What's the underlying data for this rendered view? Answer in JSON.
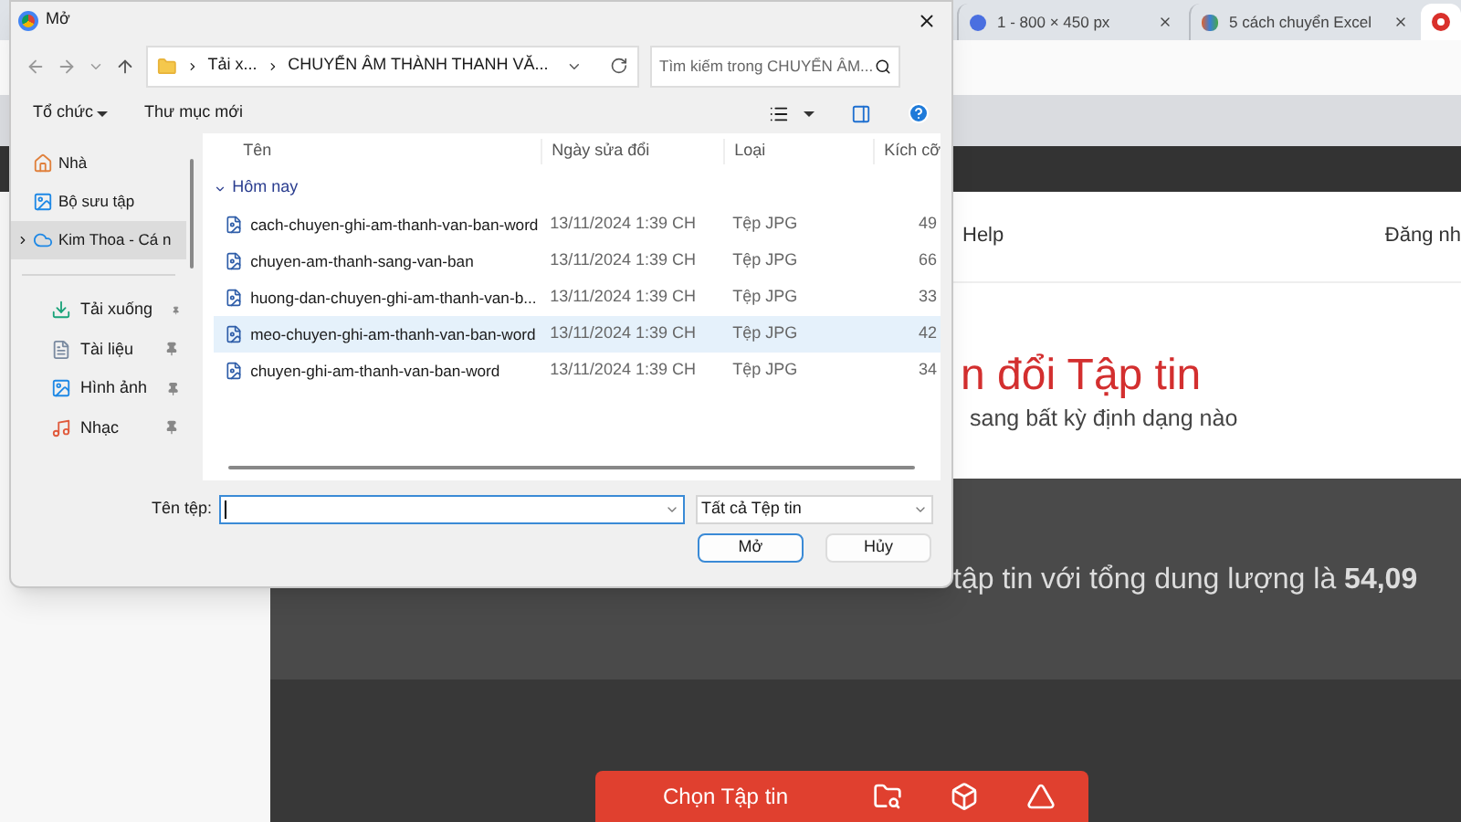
{
  "browser": {
    "tabs": [
      {
        "title": "1 - 800 × 450 px",
        "selected": false
      },
      {
        "title": "5 cách chuyển Excel",
        "selected": false
      },
      {
        "selected": true
      }
    ]
  },
  "page": {
    "nav_links": [
      "Help",
      "Đăng nh"
    ],
    "heading": "n đổi Tập tin",
    "subheading": "sang bất kỳ định dạng nào",
    "info": "tập tin với tổng dung lượng là **54,09**",
    "upload_button": "Chọn Tập tin"
  },
  "dialog": {
    "title": "Mở",
    "breadcrumb": [
      "Tải x...",
      "CHUYỂN ÂM THÀNH THANH VĂ..."
    ],
    "search": {
      "placeholder": "Tìm kiếm trong CHUYỂN ÂM..."
    },
    "toolbar": {
      "organize": "Tổ chức",
      "new_folder": "Thư mục mới"
    },
    "sidebar": {
      "locations": [
        {
          "label": "Nhà",
          "kind": "home",
          "selected": false
        },
        {
          "label": "Bộ sưu tập",
          "kind": "gallery",
          "selected": false
        },
        {
          "label": "Kim Thoa - Cá n",
          "kind": "cloud",
          "selected": true
        }
      ],
      "quick_access": [
        {
          "label": "Tải xuống",
          "kind": "downloads",
          "pinned": true
        },
        {
          "label": "Tài liệu",
          "kind": "documents",
          "pinned": true
        },
        {
          "label": "Hình ảnh",
          "kind": "pictures",
          "pinned": true
        },
        {
          "label": "Nhạc",
          "kind": "music",
          "pinned": true
        }
      ]
    },
    "columns": [
      "Tên",
      "Ngày sửa đổi",
      "Loại",
      "Kích cỡ"
    ],
    "group": {
      "label": "Hôm nay",
      "expanded": true
    },
    "rows": [
      {
        "name": "cach-chuyen-ghi-am-thanh-van-ban-word",
        "date": "13/11/2024 1:39 CH",
        "type": "Tệp JPG",
        "size": "49",
        "selected": false
      },
      {
        "name": "chuyen-am-thanh-sang-van-ban",
        "date": "13/11/2024 1:39 CH",
        "type": "Tệp JPG",
        "size": "66",
        "selected": false
      },
      {
        "name": "huong-dan-chuyen-ghi-am-thanh-van-b...",
        "date": "13/11/2024 1:39 CH",
        "type": "Tệp JPG",
        "size": "33",
        "selected": false
      },
      {
        "name": "meo-chuyen-ghi-am-thanh-van-ban-word",
        "date": "13/11/2024 1:39 CH",
        "type": "Tệp JPG",
        "size": "42",
        "selected": true
      },
      {
        "name": "chuyen-ghi-am-thanh-van-ban-word",
        "date": "13/11/2024 1:39 CH",
        "type": "Tệp JPG",
        "size": "34",
        "selected": false
      }
    ],
    "footer": {
      "filename_label": "Tên tệp:",
      "filetype": "Tất cả Tệp tin",
      "buttons": [
        {
          "label": "Mở",
          "kind": "primary"
        },
        {
          "label": "Hủy",
          "kind": "secondary"
        }
      ]
    }
  }
}
